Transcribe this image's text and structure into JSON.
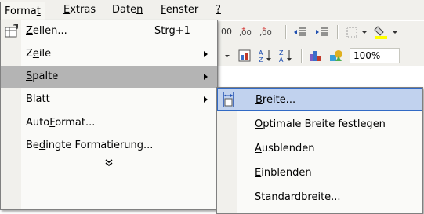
{
  "menubar": {
    "items": [
      {
        "label": "Format",
        "mnemonic": "t",
        "active": true
      },
      {
        "label": "Extras",
        "mnemonic": "E"
      },
      {
        "label": "Daten",
        "mnemonic": "n"
      },
      {
        "label": "Fenster",
        "mnemonic": "F"
      },
      {
        "label": "?",
        "mnemonic": "?"
      }
    ]
  },
  "toolbar": {
    "zoom": "100%",
    "numfmt_a": "00",
    "numfmt_b": ",00",
    "numfmt_c": ",00"
  },
  "format_menu": {
    "items": [
      {
        "label": "Zellen...",
        "mnemonic": "Z",
        "shortcut": "Strg+1",
        "submenu": false,
        "icon": "format-cells-icon"
      },
      {
        "label": "Zeile",
        "mnemonic": "e",
        "submenu": true
      },
      {
        "label": "Spalte",
        "mnemonic": "S",
        "submenu": true,
        "highlighted": true
      },
      {
        "label": "Blatt",
        "mnemonic": "B",
        "submenu": true
      },
      {
        "label": "AutoFormat...",
        "mnemonic": "F",
        "submenu": false
      },
      {
        "label": "Bedingte Formatierung...",
        "mnemonic": "d",
        "submenu": false
      }
    ],
    "expand_glyph": "»"
  },
  "spalte_submenu": {
    "items": [
      {
        "label": "Breite...",
        "mnemonic": "B",
        "highlighted": true,
        "icon": "column-width-icon"
      },
      {
        "label": "Optimale Breite festlegen",
        "mnemonic": "O"
      },
      {
        "label": "Ausblenden",
        "mnemonic": "A"
      },
      {
        "label": "Einblenden",
        "mnemonic": "E"
      },
      {
        "label": "Standardbreite...",
        "mnemonic": "S"
      }
    ]
  }
}
